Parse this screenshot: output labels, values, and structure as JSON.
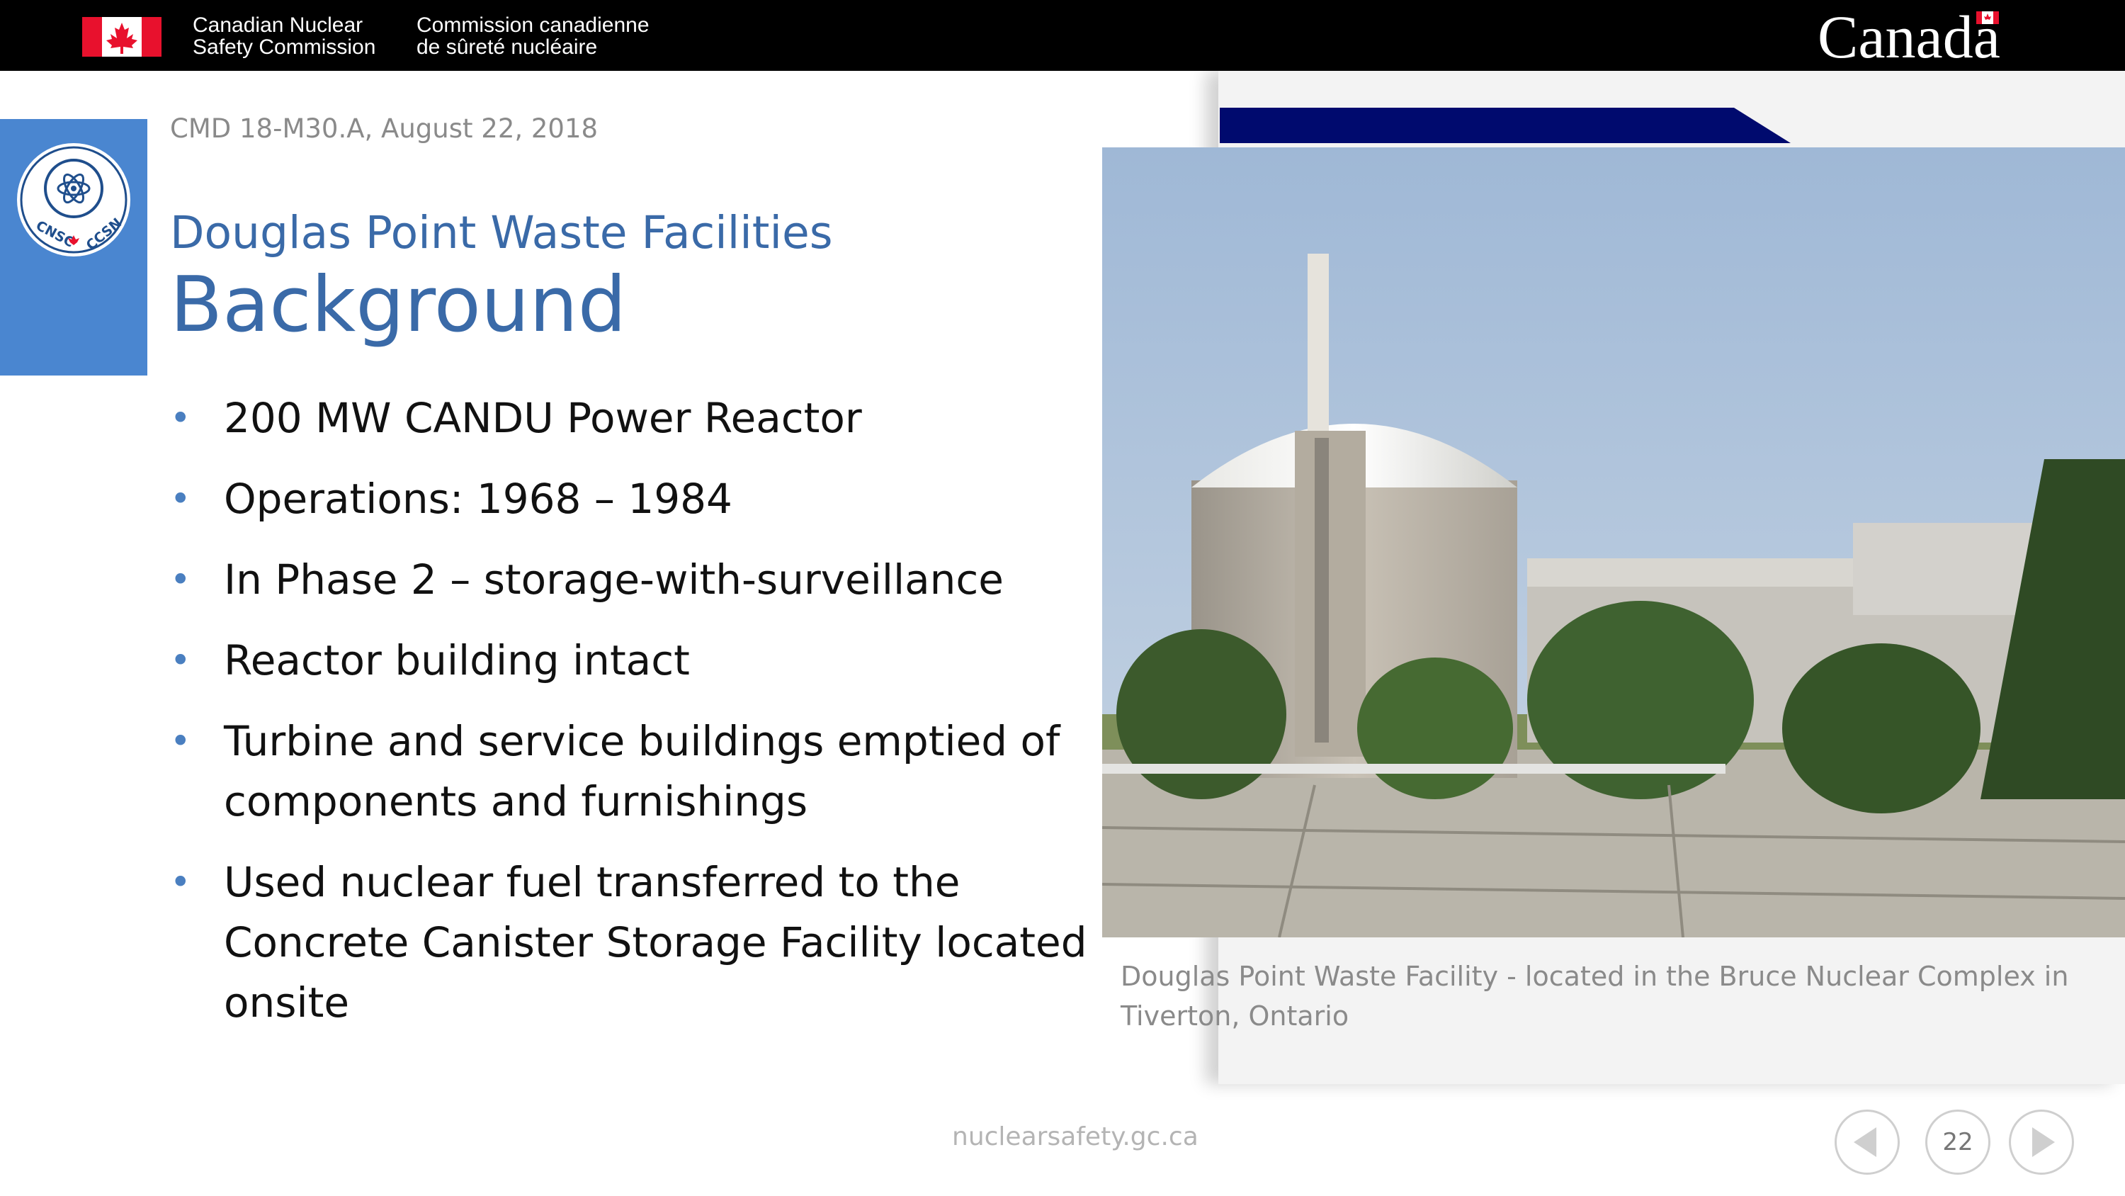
{
  "header": {
    "agency_en_line1": "Canadian Nuclear",
    "agency_en_line2": "Safety Commission",
    "agency_fr_line1": "Commission canadienne",
    "agency_fr_line2": "de sûreté nucléaire",
    "wordmark": "Canada",
    "flag_icon": "canada-flag-icon"
  },
  "logo": {
    "text_left": "CNSC",
    "text_right": "CCSN",
    "icon": "atom-icon"
  },
  "slide": {
    "cmd_reference": "CMD 18-M30.A, August 22, 2018",
    "subtitle": "Douglas Point Waste Facilities",
    "title": "Background",
    "bullets": [
      "200 MW CANDU Power Reactor",
      "Operations: 1968 – 1984",
      "In Phase 2 – storage-with-surveillance",
      "Reactor building intact",
      "Turbine and service buildings emptied of components and furnishings",
      "Used nuclear fuel transferred to the Concrete Canister Storage Facility located onsite"
    ]
  },
  "photo": {
    "caption": "Douglas Point Waste Facility - located in the Bruce Nuclear Complex in Tiverton, Ontario"
  },
  "footer": {
    "url": "nuclearsafety.gc.ca",
    "page_number": "22"
  },
  "colors": {
    "accent_blue": "#4a86d0",
    "title_blue": "#3a6aa8",
    "navy": "#000a6e",
    "flag_red": "#e8112d"
  }
}
